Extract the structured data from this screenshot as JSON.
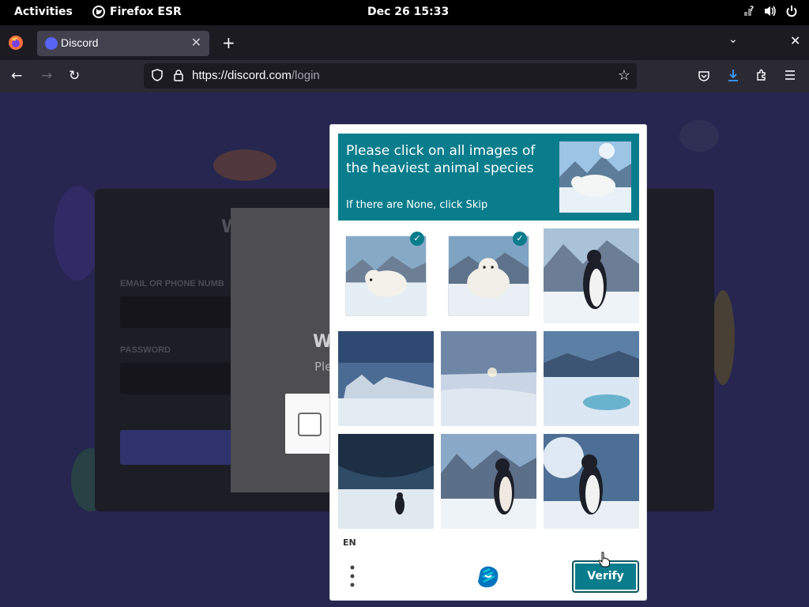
{
  "topbar": {
    "activities": "Activities",
    "app_name": "Firefox ESR",
    "clock": "Dec 26  15:33"
  },
  "browser": {
    "tab_title": "Discord",
    "url_host": "https://discord.com",
    "url_path": "/login"
  },
  "background_page": {
    "modal_heading": "W",
    "modal_text": "Ple"
  },
  "captcha": {
    "prompt": "Please click on all images of the heaviest animal species",
    "hint": "If there are None, click Skip",
    "language": "EN",
    "verify_label": "Verify",
    "tiles": [
      {
        "subject": "polar bear",
        "selected": true
      },
      {
        "subject": "polar bear",
        "selected": true
      },
      {
        "subject": "penguin",
        "selected": false
      },
      {
        "subject": "snowy landscape",
        "selected": false
      },
      {
        "subject": "snowy landscape",
        "selected": false
      },
      {
        "subject": "snowy landscape",
        "selected": false
      },
      {
        "subject": "penguin",
        "selected": false
      },
      {
        "subject": "penguin",
        "selected": false
      },
      {
        "subject": "penguin",
        "selected": false
      }
    ]
  },
  "colors": {
    "captcha_accent": "#0a7d8c",
    "page_bg": "#262650",
    "tab_bg": "#42414d"
  }
}
